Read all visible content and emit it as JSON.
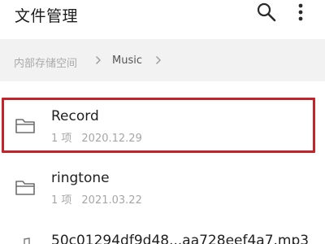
{
  "header": {
    "title": "文件管理",
    "search_icon": "search-icon",
    "more_icon": "more-vertical-icon"
  },
  "breadcrumb": {
    "items": [
      "内部存储空间",
      "Music"
    ]
  },
  "list": {
    "items": [
      {
        "name": "Record",
        "count": "1 项",
        "date": "2020.12.29",
        "icon": "folder-icon",
        "highlighted": true
      },
      {
        "name": "ringtone",
        "count": "1 项",
        "date": "2021.03.22",
        "icon": "folder-icon",
        "highlighted": false
      },
      {
        "name": "50c01294df9d48...aa728eef4a7.mp3",
        "icon": "music-file-icon"
      }
    ]
  },
  "colors": {
    "highlight_border": "#c3242b",
    "breadcrumb_bg": "#f2f2f2"
  }
}
